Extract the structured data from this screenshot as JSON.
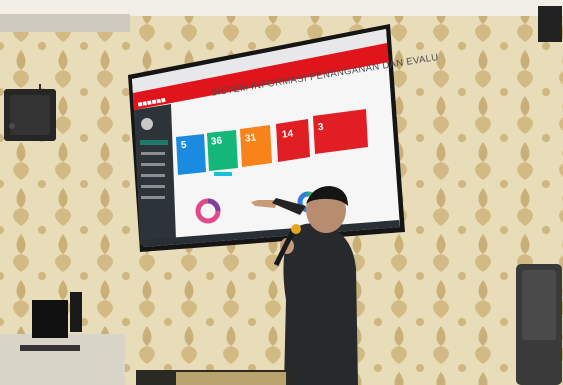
{
  "screen": {
    "app_title": "SISTEM INFORMASI PENANGANAN DAN EVALU",
    "cards": [
      {
        "value": "5"
      },
      {
        "value": "36"
      },
      {
        "value": "31"
      },
      {
        "value": "14"
      },
      {
        "value": "3"
      }
    ]
  }
}
